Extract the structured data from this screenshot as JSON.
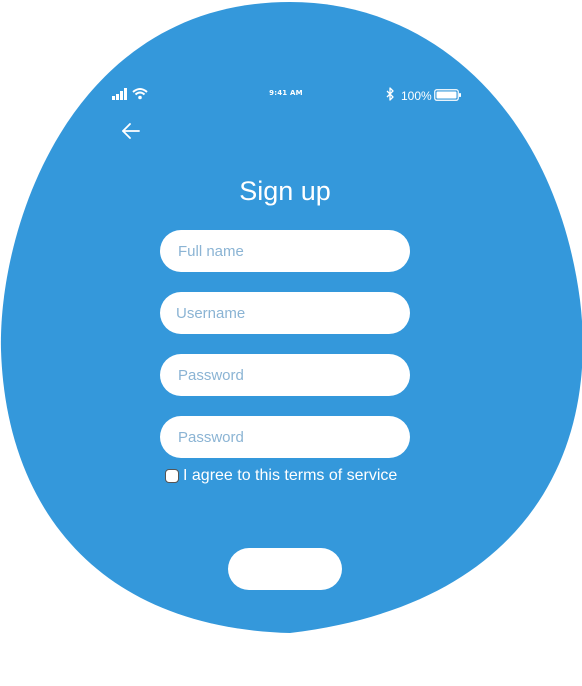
{
  "colors": {
    "primary": "#3498db",
    "surface": "#ffffff",
    "placeholder": "#8bb4d4"
  },
  "status_bar": {
    "time": "9:41 AM",
    "battery": "100%",
    "icons": [
      "signal-icon",
      "wifi-icon",
      "bluetooth-icon",
      "battery-icon"
    ]
  },
  "header": {
    "back_icon": "arrow-left-icon",
    "title": "Sign up"
  },
  "form": {
    "full_name": {
      "placeholder": "Full name",
      "value": ""
    },
    "username": {
      "placeholder": "Username",
      "value": ""
    },
    "password": {
      "placeholder": "Password",
      "value": ""
    },
    "confirm_password": {
      "placeholder": "Password",
      "value": ""
    },
    "terms": {
      "label": "I agree to this terms of service",
      "checked": false
    },
    "submit_label": ""
  }
}
